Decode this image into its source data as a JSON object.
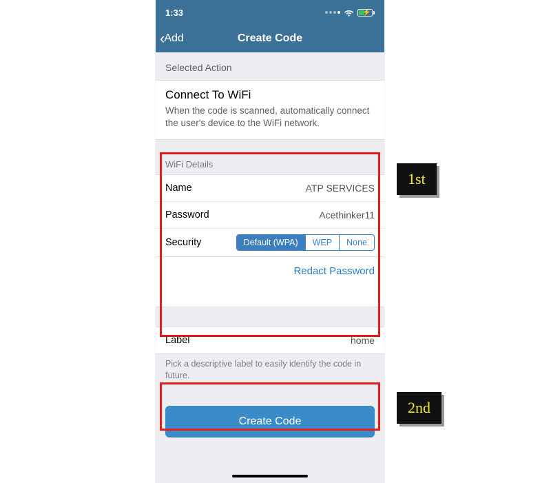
{
  "status": {
    "time": "1:33"
  },
  "nav": {
    "back_label": "Add",
    "title": "Create Code"
  },
  "selected_action": {
    "header": "Selected Action",
    "title": "Connect To WiFi",
    "description": "When the code is scanned, automatically connect the user's device to the WiFi network."
  },
  "wifi": {
    "header": "WiFi Details",
    "name_label": "Name",
    "name_value": "ATP SERVICES",
    "password_label": "Password",
    "password_value": "Acethinker11",
    "security_label": "Security",
    "security_options": {
      "default": "Default (WPA)",
      "wep": "WEP",
      "none": "None"
    },
    "redact_label": "Redact Password"
  },
  "label_row": {
    "label": "Label",
    "value": "home"
  },
  "footer_note": "Pick a descriptive label to easily identify the code in future.",
  "create_button": "Create Code",
  "annotations": {
    "first": "1st",
    "second": "2nd"
  }
}
